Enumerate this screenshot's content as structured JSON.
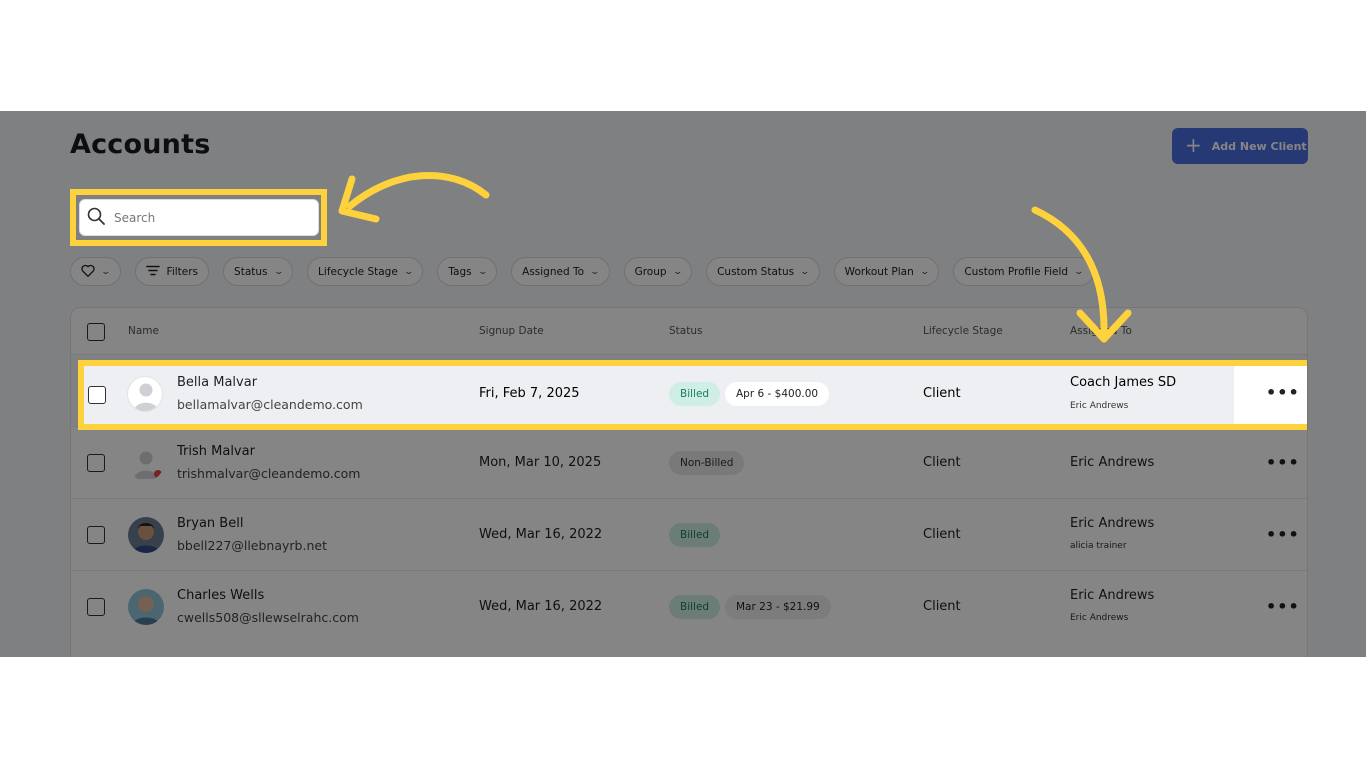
{
  "page": {
    "title": "Accounts"
  },
  "header": {
    "add_button_label": "Add New Client"
  },
  "search": {
    "placeholder": "Search"
  },
  "filters": [
    {
      "label": ""
    },
    {
      "label": "Filters"
    },
    {
      "label": "Status"
    },
    {
      "label": "Lifecycle Stage"
    },
    {
      "label": "Tags"
    },
    {
      "label": "Assigned To"
    },
    {
      "label": "Group"
    },
    {
      "label": "Custom Status"
    },
    {
      "label": "Workout Plan"
    },
    {
      "label": "Custom Profile Field"
    }
  ],
  "table": {
    "columns": [
      "Name",
      "Signup Date",
      "Status",
      "Lifecycle Stage",
      "Assigned To"
    ],
    "rows": [
      {
        "name": "Bella Malvar",
        "email": "bellamalvar@cleandemo.com",
        "signup": "Fri, Feb 7, 2025",
        "status": "Billed",
        "plan": "Apr 6 - $400.00",
        "stage": "Client",
        "assigned": "Coach James SD",
        "assigned_sub": "Eric Andrews"
      },
      {
        "name": "Trish Malvar",
        "email": "trishmalvar@cleandemo.com",
        "signup": "Mon, Mar 10, 2025",
        "status": "Non-Billed",
        "plan": "",
        "stage": "Client",
        "assigned": "Eric Andrews",
        "assigned_sub": ""
      },
      {
        "name": "Bryan Bell",
        "email": "bbell227@llebnayrb.net",
        "signup": "Wed, Mar 16, 2022",
        "status": "Billed",
        "plan": "",
        "stage": "Client",
        "assigned": "Eric Andrews",
        "assigned_sub": "alicia trainer"
      },
      {
        "name": "Charles Wells",
        "email": "cwells508@sllewselrahc.com",
        "signup": "Wed, Mar 16, 2022",
        "status": "Billed",
        "plan": "Mar 23 - $21.99",
        "stage": "Client",
        "assigned": "Eric Andrews",
        "assigned_sub": "Eric Andrews"
      }
    ],
    "more_label": "•••"
  },
  "colors": {
    "accent": "#4a6ee0",
    "highlight": "#fdd23d",
    "billed_bg": "#cfeee5",
    "billed_text": "#1d7a63"
  }
}
